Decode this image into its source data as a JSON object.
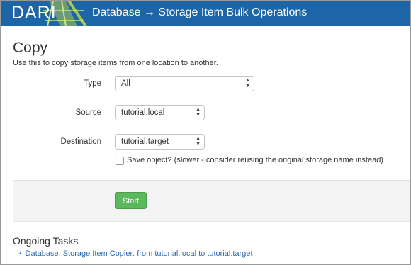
{
  "header": {
    "logo_text": "DARI",
    "title": "Database → Storage Item Bulk Operations"
  },
  "page": {
    "title": "Copy",
    "description": "Use this to copy storage items from one location to another."
  },
  "form": {
    "type": {
      "label": "Type",
      "value": "All"
    },
    "source": {
      "label": "Source",
      "value": "tutorial.local"
    },
    "destination": {
      "label": "Destination",
      "value": "tutorial.target"
    },
    "save_object": {
      "label": "Save object? (slower - consider reusing the original storage name instead)",
      "checked": false
    },
    "start_label": "Start"
  },
  "tasks": {
    "title": "Ongoing Tasks",
    "items": [
      {
        "label": "Database: Storage Item Copier: from tutorial.local to tutorial.target"
      }
    ]
  },
  "colors": {
    "header_bg": "#1d65a6",
    "logo_accent": "#a8c94c",
    "start_button": "#5cb85c",
    "link": "#2a6ab3"
  }
}
